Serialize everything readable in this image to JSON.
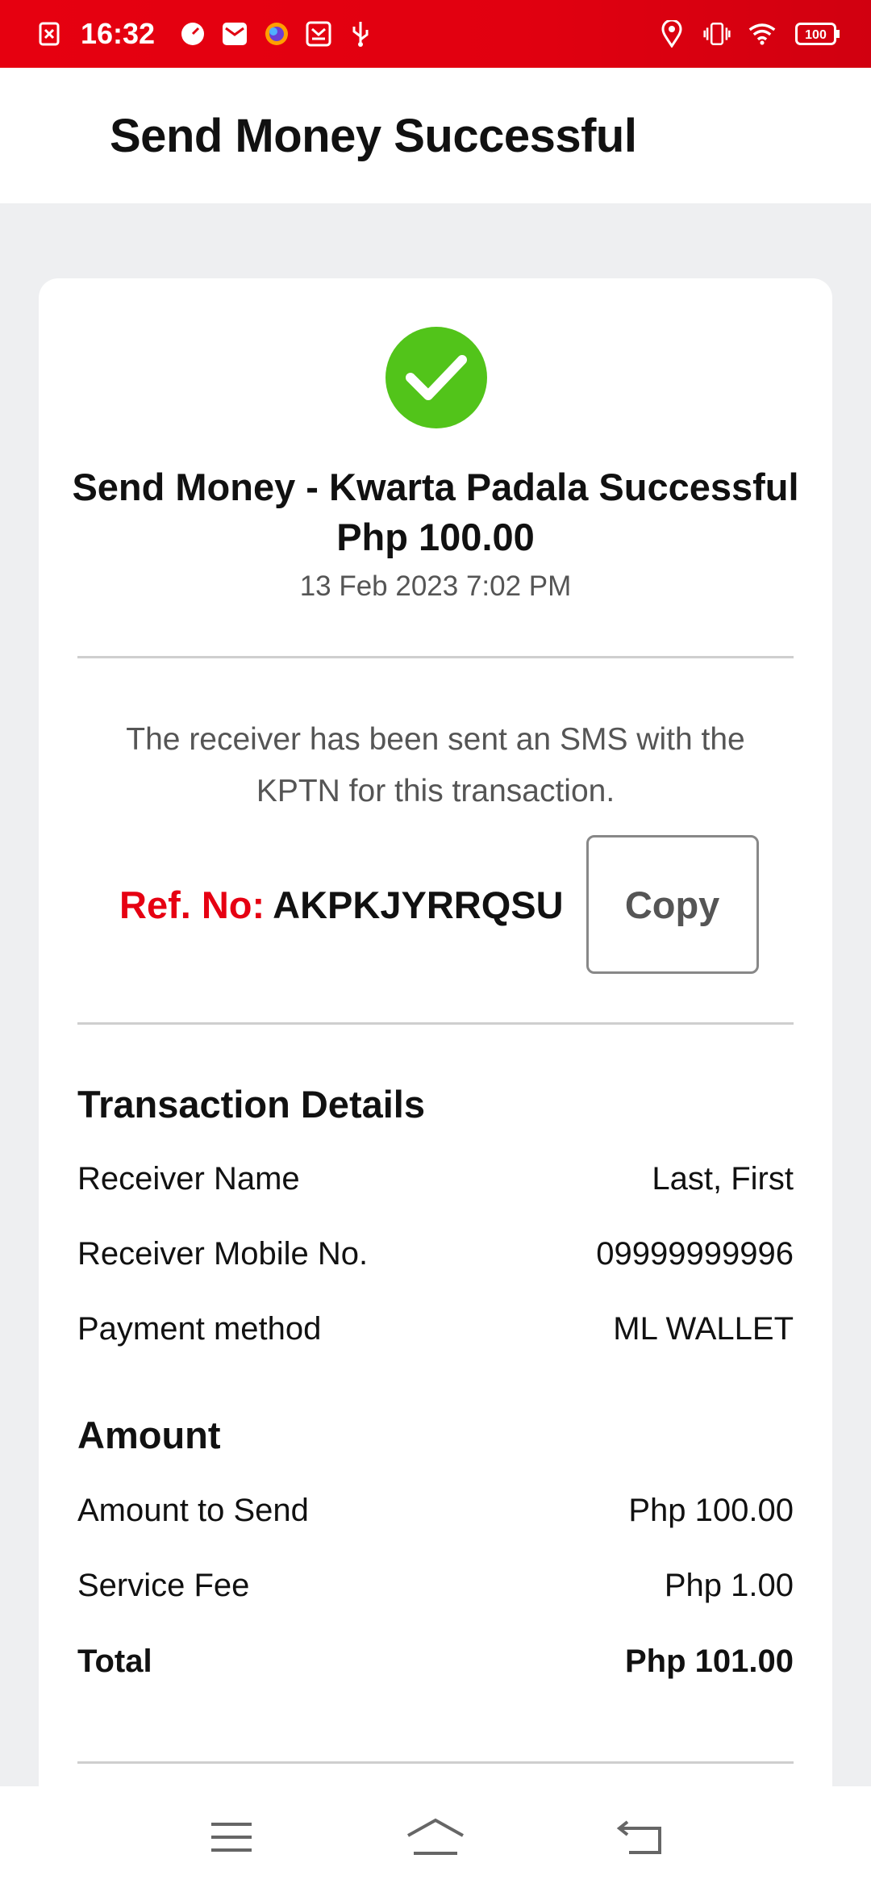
{
  "status_bar": {
    "time": "16:32",
    "battery": "100",
    "icons_left": [
      "notification-icon",
      "speedometer-icon",
      "mail-icon",
      "browser-icon",
      "inbox-icon",
      "usb-icon"
    ],
    "icons_right": [
      "location-icon",
      "vibrate-icon",
      "wifi-icon",
      "battery-icon"
    ]
  },
  "app_bar": {
    "title": "Send Money Successful"
  },
  "receipt": {
    "headline_line1": "Send Money - Kwarta Padala Successful",
    "headline_line2": "Php 100.00",
    "date": "13 Feb 2023 7:02 PM",
    "sms_notice": "The receiver has been sent an SMS with the KPTN for this transaction.",
    "ref_label": "Ref. No:",
    "ref_value": "AKPKJYRRQSU",
    "copy_label": "Copy"
  },
  "transaction_details": {
    "title": "Transaction Details",
    "rows": [
      {
        "label": "Receiver Name",
        "value": "Last, First"
      },
      {
        "label": "Receiver Mobile No.",
        "value": "09999999996"
      },
      {
        "label": "Payment method",
        "value": "ML WALLET"
      }
    ]
  },
  "amount": {
    "title": "Amount",
    "rows": [
      {
        "label": "Amount to Send",
        "value": "Php 100.00"
      },
      {
        "label": "Service Fee",
        "value": "Php 1.00"
      }
    ],
    "total_label": "Total",
    "total_value": "Php 101.00"
  },
  "colors": {
    "brand_red": "#e60012",
    "success_green": "#52c41a"
  }
}
